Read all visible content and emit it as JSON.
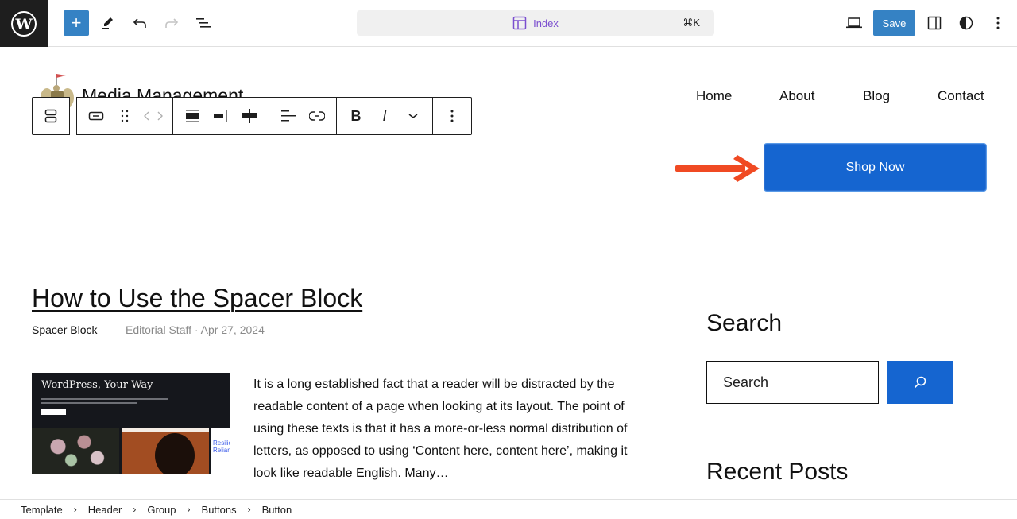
{
  "topbar": {
    "add_block_label": "+",
    "document_title": "Index",
    "command_shortcut": "⌘K",
    "save_label": "Save",
    "icons": [
      "wordpress-logo",
      "plus-icon",
      "pencil-icon",
      "undo-icon",
      "redo-icon",
      "list-view-icon",
      "layout-icon",
      "laptop-preview-icon",
      "sidebar-toggle-icon",
      "half-circle-styles-icon",
      "kebab-menu-icon"
    ]
  },
  "header": {
    "site_title": "Media Management",
    "nav": [
      "Home",
      "About",
      "Blog",
      "Contact"
    ],
    "button_label": "Shop Now",
    "annotation_arrow_color": "#f04a23",
    "button_color": "#1565d0"
  },
  "block_toolbar": {
    "groups": [
      [
        "parent-select-icon"
      ],
      [
        "button-block-icon",
        "drag-handle-icon",
        "move-arrows-icon"
      ],
      [
        "justify-stretch-icon",
        "justify-right-icon",
        "justify-center-icon"
      ],
      [
        "align-text-icon",
        "link-icon"
      ],
      [
        "bold-icon",
        "italic-icon",
        "chevron-down-icon"
      ],
      [
        "more-options-icon"
      ]
    ],
    "bold_glyph": "B",
    "italic_glyph": "I"
  },
  "post": {
    "title": "How to Use the Spacer Block",
    "category": "Spacer Block",
    "meta": "Editorial Staff · Apr 27, 2024",
    "thumbnail": {
      "headline": "WordPress, Your Way",
      "card_text": "Resilie Relian"
    },
    "excerpt": "It is a long established fact that a reader will be distracted by the readable content of a page when looking at its layout. The point of using these texts is that it has a more-or-less normal distribution of letters, as opposed to using ‘Content here, content here’, making it look like readable English. Many…"
  },
  "sidebar": {
    "search_heading": "Search",
    "search_placeholder": "Search",
    "recent_heading": "Recent Posts"
  },
  "breadcrumb": [
    "Template",
    "Header",
    "Group",
    "Buttons",
    "Button"
  ]
}
